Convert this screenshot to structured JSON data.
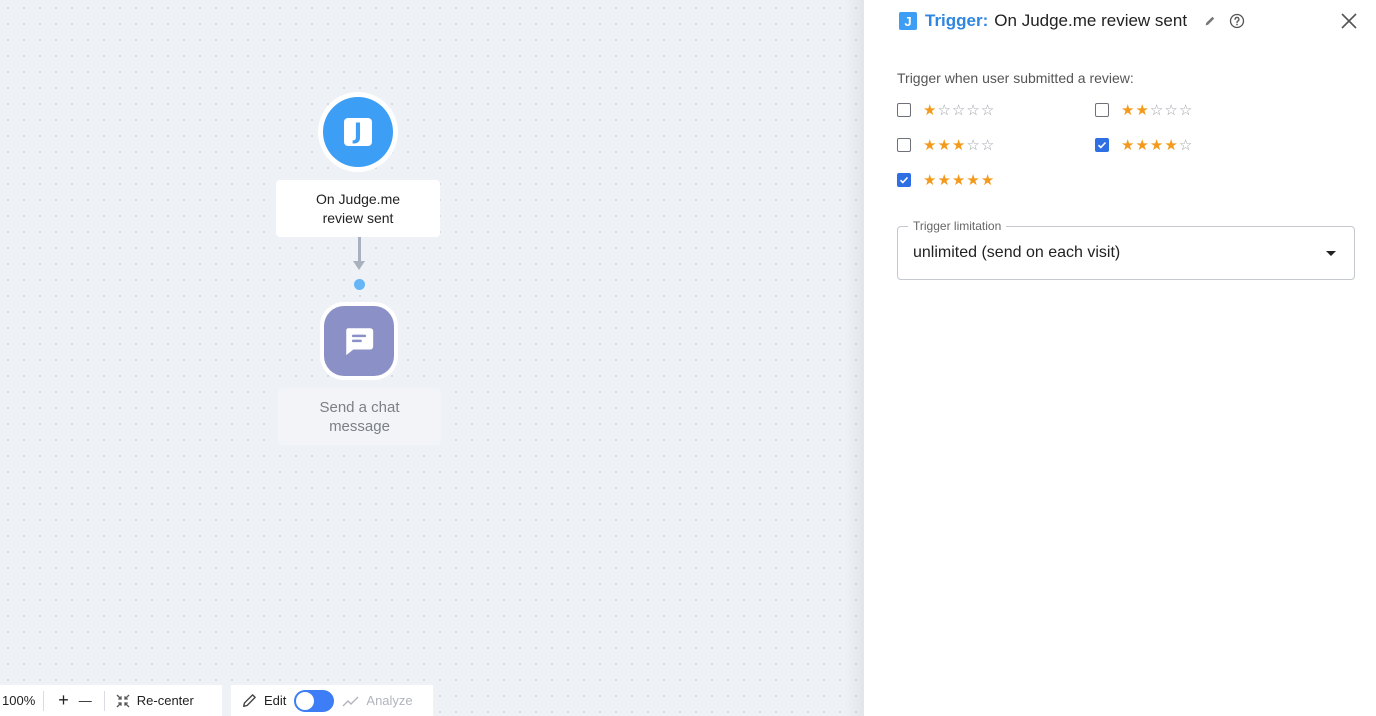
{
  "canvas": {
    "trigger_node": {
      "badge_letter": "J",
      "label_line1": "On Judge.me",
      "label_line2": "review sent"
    },
    "action_node": {
      "label_line1": "Send a chat",
      "label_line2": "message"
    }
  },
  "toolbar": {
    "zoom_level": "100%",
    "zoom_in_symbol": "+",
    "zoom_out_symbol": "—",
    "recenter_label": "Re-center",
    "edit_label": "Edit",
    "analyze_label": "Analyze",
    "mode_toggle_on": true
  },
  "panel": {
    "badge_letter": "J",
    "title_prefix": "Trigger:",
    "title": "On Judge.me review sent",
    "section_label": "Trigger when user submitted a review:",
    "ratings": [
      {
        "stars": 1,
        "checked": false
      },
      {
        "stars": 2,
        "checked": false
      },
      {
        "stars": 3,
        "checked": false
      },
      {
        "stars": 4,
        "checked": true
      },
      {
        "stars": 5,
        "checked": true
      }
    ],
    "limitation": {
      "label": "Trigger limitation",
      "value": "unlimited (send on each visit)"
    }
  },
  "colors": {
    "accent_blue": "#3d9ef5",
    "star_filled": "#f39a1c",
    "checkbox_checked": "#2f6fe4",
    "action_node": "#8b91c7"
  },
  "icons": {
    "edit_title": "pencil-icon",
    "help": "help-circle-icon",
    "close": "close-icon",
    "recenter": "recenter-icon",
    "edit_mode": "pencil-icon",
    "analyze": "trend-line-icon",
    "chat": "chat-message-icon"
  }
}
